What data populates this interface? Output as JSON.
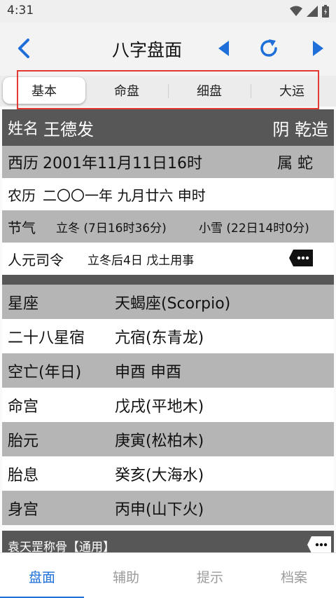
{
  "status_bar": {
    "time": "4:31"
  },
  "header": {
    "title": "八字盘面"
  },
  "tabs": [
    {
      "label": "基本",
      "active": true
    },
    {
      "label": "命盘",
      "active": false
    },
    {
      "label": "细盘",
      "active": false
    },
    {
      "label": "大运",
      "active": false
    }
  ],
  "profile": {
    "name_label": "姓名",
    "name_value": "王德发",
    "gender": "阴 乾造",
    "solar_label": "西历",
    "solar_value": "2001年11月11日16时",
    "zodiac": "属 蛇",
    "lunar_label": "农历",
    "lunar_value": "二〇〇一年 九月廿六 申时",
    "solar_term_label": "节气",
    "solar_term_1": "立冬 (7日16时36分)",
    "solar_term_2": "小雪 (22日14时0分)",
    "commander_label": "人元司令",
    "commander_value": "立冬后4日 戊土用事"
  },
  "details": [
    {
      "label": "星座",
      "value": "天蝎座(Scorpio)"
    },
    {
      "label": "二十八星宿",
      "value": "亢宿(东青龙)"
    },
    {
      "label": "空亡(年日)",
      "value": "申酉 申酉"
    },
    {
      "label": "命宫",
      "value": "戊戌(平地木)"
    },
    {
      "label": "胎元",
      "value": "庚寅(松柏木)"
    },
    {
      "label": "胎息",
      "value": "癸亥(大海水)"
    },
    {
      "label": "身宫",
      "value": "丙申(山下火)"
    }
  ],
  "bone_section": {
    "title": "袁天罡称骨【通用】"
  },
  "bottom_nav": [
    {
      "label": "盘面",
      "active": true
    },
    {
      "label": "辅助",
      "active": false
    },
    {
      "label": "提示",
      "active": false
    },
    {
      "label": "档案",
      "active": false
    }
  ],
  "colors": {
    "accent": "#1e6fd9",
    "dark_row": "#575757",
    "gray_row": "#b5b5b5",
    "highlight": "#e53935"
  }
}
